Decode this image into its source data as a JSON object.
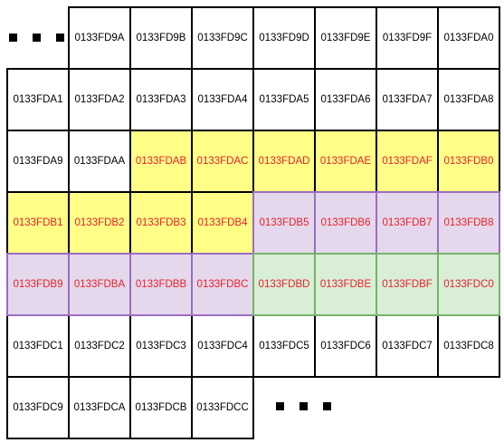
{
  "ellipsis_start": "■ ■ ■",
  "ellipsis_end": "■ ■ ■",
  "rows": [
    [
      {
        "label": "",
        "fill": "empty"
      },
      {
        "label": "0133FD9A",
        "fill": "white"
      },
      {
        "label": "0133FD9B",
        "fill": "white"
      },
      {
        "label": "0133FD9C",
        "fill": "white"
      },
      {
        "label": "0133FD9D",
        "fill": "white"
      },
      {
        "label": "0133FD9E",
        "fill": "white"
      },
      {
        "label": "0133FD9F",
        "fill": "white"
      },
      {
        "label": "0133FDA0",
        "fill": "white"
      }
    ],
    [
      {
        "label": "0133FDA1",
        "fill": "white"
      },
      {
        "label": "0133FDA2",
        "fill": "white"
      },
      {
        "label": "0133FDA3",
        "fill": "white"
      },
      {
        "label": "0133FDA4",
        "fill": "white"
      },
      {
        "label": "0133FDA5",
        "fill": "white"
      },
      {
        "label": "0133FDA6",
        "fill": "white"
      },
      {
        "label": "0133FDA7",
        "fill": "white"
      },
      {
        "label": "0133FDA8",
        "fill": "white"
      }
    ],
    [
      {
        "label": "0133FDA9",
        "fill": "white"
      },
      {
        "label": "0133FDAA",
        "fill": "white"
      },
      {
        "label": "0133FDAB",
        "fill": "yellow"
      },
      {
        "label": "0133FDAC",
        "fill": "yellow"
      },
      {
        "label": "0133FDAD",
        "fill": "yellow"
      },
      {
        "label": "0133FDAE",
        "fill": "yellow"
      },
      {
        "label": "0133FDAF",
        "fill": "yellow"
      },
      {
        "label": "0133FDB0",
        "fill": "yellow"
      }
    ],
    [
      {
        "label": "0133FDB1",
        "fill": "yellow"
      },
      {
        "label": "0133FDB2",
        "fill": "yellow"
      },
      {
        "label": "0133FDB3",
        "fill": "yellow"
      },
      {
        "label": "0133FDB4",
        "fill": "yellow"
      },
      {
        "label": "0133FDB5",
        "fill": "purple"
      },
      {
        "label": "0133FDB6",
        "fill": "purple"
      },
      {
        "label": "0133FDB7",
        "fill": "purple"
      },
      {
        "label": "0133FDB8",
        "fill": "purple"
      }
    ],
    [
      {
        "label": "0133FDB9",
        "fill": "purple"
      },
      {
        "label": "0133FDBA",
        "fill": "purple"
      },
      {
        "label": "0133FDBB",
        "fill": "purple"
      },
      {
        "label": "0133FDBC",
        "fill": "purple"
      },
      {
        "label": "0133FDBD",
        "fill": "green"
      },
      {
        "label": "0133FDBE",
        "fill": "green"
      },
      {
        "label": "0133FDBF",
        "fill": "green"
      },
      {
        "label": "0133FDC0",
        "fill": "green"
      }
    ],
    [
      {
        "label": "0133FDC1",
        "fill": "white"
      },
      {
        "label": "0133FDC2",
        "fill": "white"
      },
      {
        "label": "0133FDC3",
        "fill": "white"
      },
      {
        "label": "0133FDC4",
        "fill": "white"
      },
      {
        "label": "0133FDC5",
        "fill": "white"
      },
      {
        "label": "0133FDC6",
        "fill": "white"
      },
      {
        "label": "0133FDC7",
        "fill": "white"
      },
      {
        "label": "0133FDC8",
        "fill": "white"
      }
    ],
    [
      {
        "label": "0133FDC9",
        "fill": "white"
      },
      {
        "label": "0133FDCA",
        "fill": "white"
      },
      {
        "label": "0133FDCB",
        "fill": "white"
      },
      {
        "label": "0133FDCC",
        "fill": "white"
      },
      {
        "label": "",
        "fill": "empty"
      },
      {
        "label": "",
        "fill": "empty"
      },
      {
        "label": "",
        "fill": "empty"
      },
      {
        "label": "",
        "fill": "empty"
      }
    ]
  ],
  "styles": {
    "white": {
      "bg": "#ffffff",
      "border": "#000000",
      "text": "#000000"
    },
    "yellow": {
      "bg": "#ffff88",
      "border": "#000000",
      "text": "#e8202a"
    },
    "purple": {
      "bg": "#e5d8ec",
      "border": "#9b6cc0",
      "text": "#e8202a"
    },
    "green": {
      "bg": "#d8eed7",
      "border": "#77b26a",
      "text": "#e8202a"
    }
  }
}
